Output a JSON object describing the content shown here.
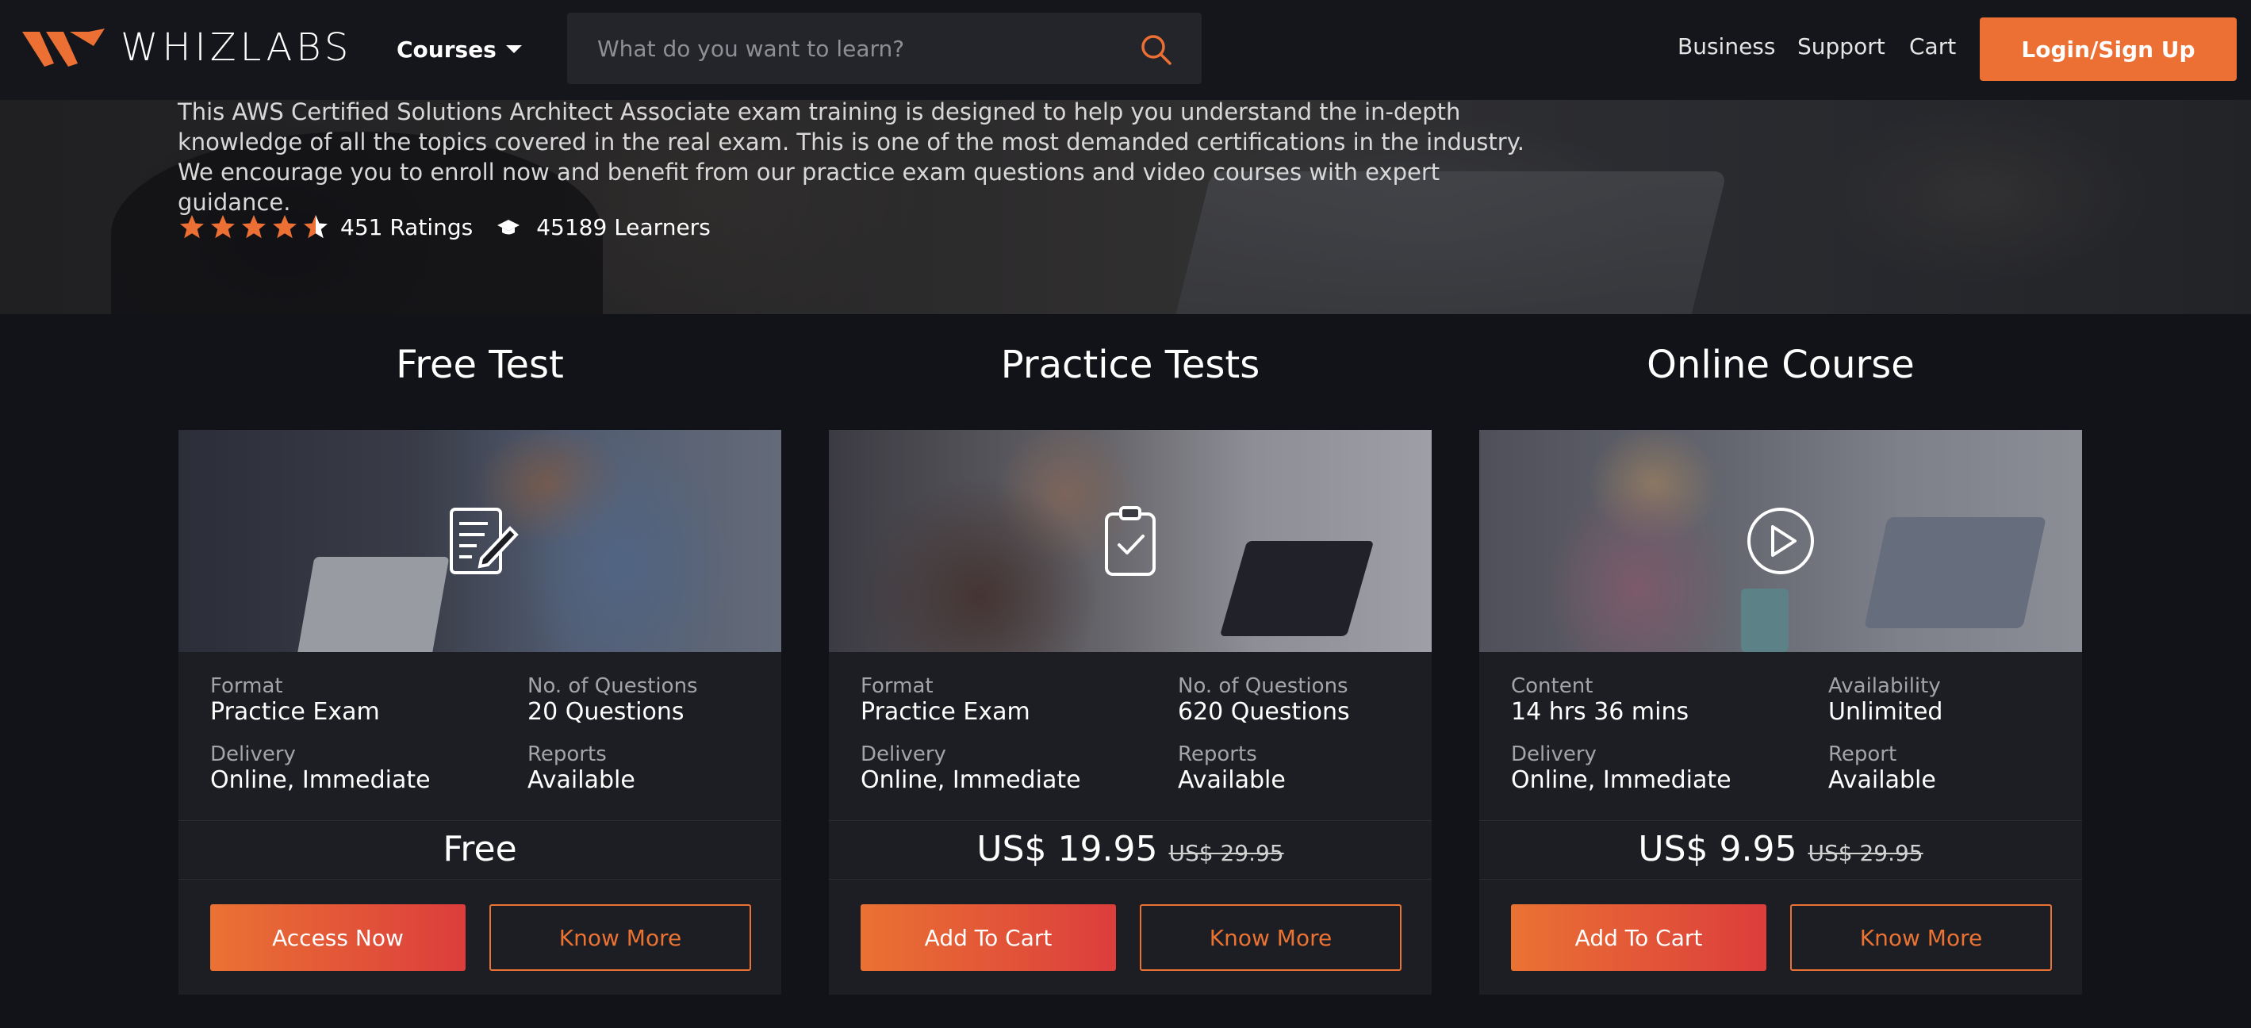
{
  "header": {
    "logo_text": "WHIZLABS",
    "courses_label": "Courses",
    "search_placeholder": "What do you want to learn?",
    "nav": [
      "Business",
      "Support",
      "Cart"
    ],
    "login_label": "Login/Sign Up",
    "brand_color": "#ec6f34"
  },
  "hero": {
    "description": "This AWS Certified Solutions Architect Associate exam training is designed to help you understand the in-depth knowledge of all the topics covered in the real exam. This is one of the most demanded certifications in the industry. We encourage you to enroll now and benefit from our practice exam questions and video courses with expert guidance.",
    "rating_stars": 4.5,
    "ratings_text": "451 Ratings",
    "learners_text": "45189 Learners"
  },
  "cards": [
    {
      "title": "Free Test",
      "icon": "document-edit-icon",
      "specs": [
        {
          "label": "Format",
          "value": "Practice Exam"
        },
        {
          "label": "No. of Questions",
          "value": "20 Questions"
        },
        {
          "label": "Delivery",
          "value": "Online, Immediate"
        },
        {
          "label": "Reports",
          "value": "Available"
        }
      ],
      "price": "Free",
      "old_price": "",
      "primary_button": "Access Now",
      "secondary_button": "Know More"
    },
    {
      "title": "Practice Tests",
      "icon": "clipboard-check-icon",
      "specs": [
        {
          "label": "Format",
          "value": "Practice Exam"
        },
        {
          "label": "No. of Questions",
          "value": "620 Questions"
        },
        {
          "label": "Delivery",
          "value": "Online, Immediate"
        },
        {
          "label": "Reports",
          "value": "Available"
        }
      ],
      "price": "US$ 19.95",
      "old_price": "US$ 29.95",
      "primary_button": "Add To Cart",
      "secondary_button": "Know More"
    },
    {
      "title": "Online Course",
      "icon": "play-circle-icon",
      "specs": [
        {
          "label": "Content",
          "value": "14 hrs 36 mins"
        },
        {
          "label": "Availability",
          "value": "Unlimited"
        },
        {
          "label": "Delivery",
          "value": "Online, Immediate"
        },
        {
          "label": "Report",
          "value": "Available"
        }
      ],
      "price": "US$ 9.95",
      "old_price": "US$ 29.95",
      "primary_button": "Add To Cart",
      "secondary_button": "Know More"
    }
  ]
}
